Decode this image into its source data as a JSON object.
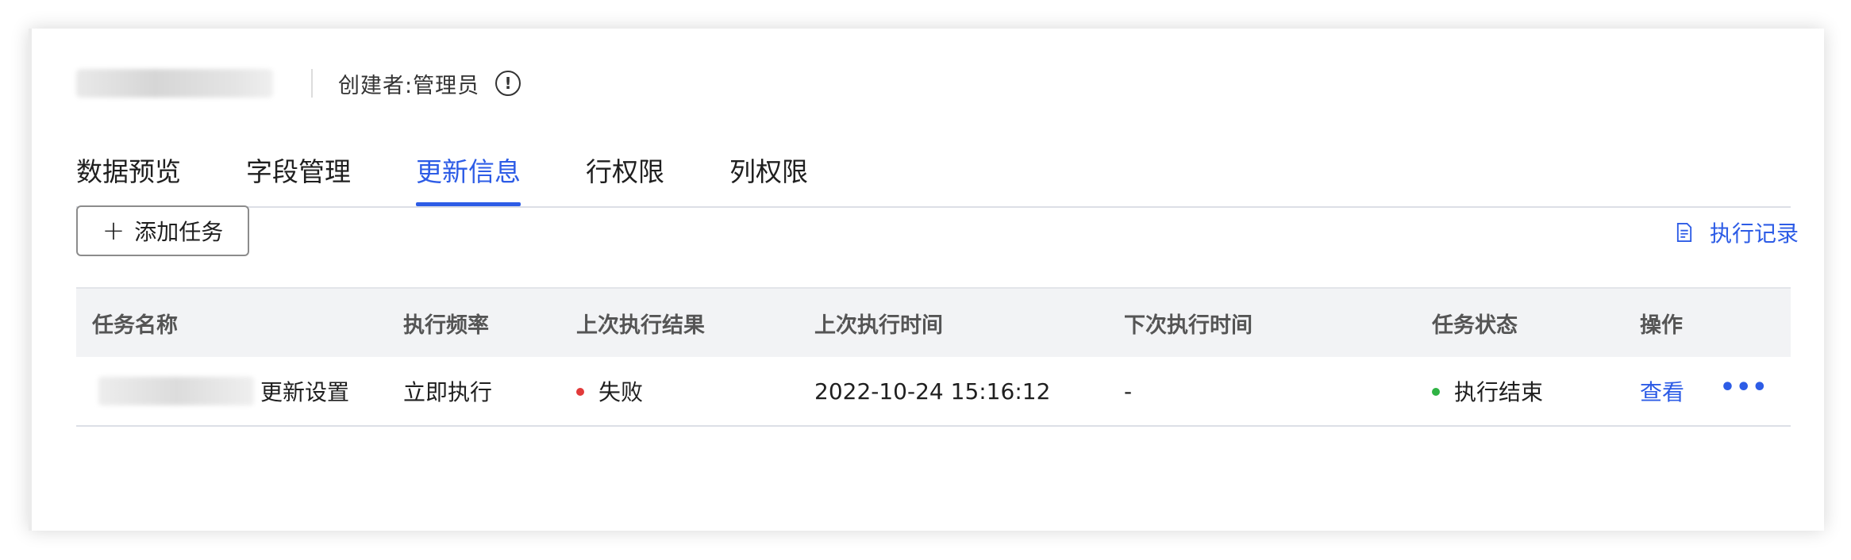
{
  "header": {
    "creator_label": "创建者:管理员",
    "info_icon": "info-icon"
  },
  "tabs": [
    {
      "label": "数据预览",
      "active": false
    },
    {
      "label": "字段管理",
      "active": false
    },
    {
      "label": "更新信息",
      "active": true
    },
    {
      "label": "行权限",
      "active": false
    },
    {
      "label": "列权限",
      "active": false
    }
  ],
  "toolbar": {
    "add_task_label": "添加任务",
    "add_icon": "plus-icon",
    "exec_record_label": "执行记录",
    "exec_record_icon": "document-icon"
  },
  "table": {
    "columns": [
      "任务名称",
      "执行频率",
      "上次执行结果",
      "上次执行时间",
      "下次执行时间",
      "任务状态",
      "操作"
    ],
    "rows": [
      {
        "name_suffix": "更新设置",
        "frequency": "立即执行",
        "last_result": "失败",
        "last_time": "2022-10-24 15:16:12",
        "next_time": "-",
        "status": "执行结束",
        "action_view": "查看",
        "action_more": "•••"
      }
    ]
  },
  "colors": {
    "accent": "#2d5ce6",
    "fail": "#e23a3a",
    "success": "#2fb344"
  }
}
